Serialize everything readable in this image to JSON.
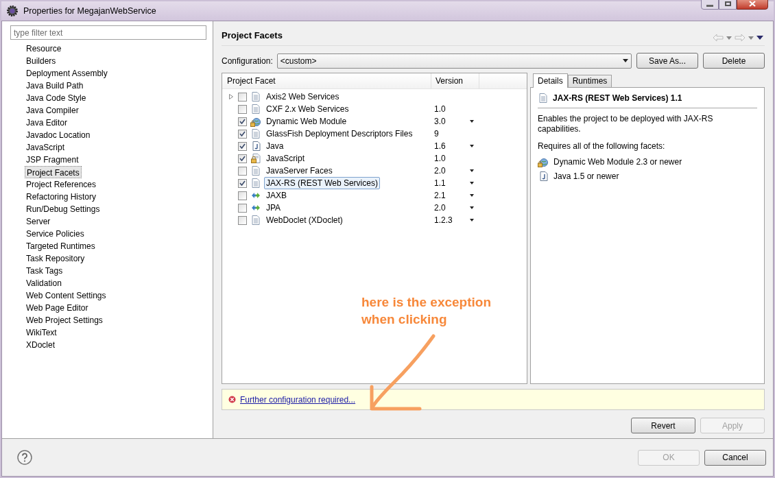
{
  "window": {
    "title": "Properties for MegajanWebService"
  },
  "filter": {
    "placeholder": "type filter text"
  },
  "sidebar": {
    "items": [
      {
        "label": "Resource",
        "selected": false
      },
      {
        "label": "Builders",
        "selected": false
      },
      {
        "label": "Deployment Assembly",
        "selected": false
      },
      {
        "label": "Java Build Path",
        "selected": false
      },
      {
        "label": "Java Code Style",
        "selected": false
      },
      {
        "label": "Java Compiler",
        "selected": false
      },
      {
        "label": "Java Editor",
        "selected": false
      },
      {
        "label": "Javadoc Location",
        "selected": false
      },
      {
        "label": "JavaScript",
        "selected": false
      },
      {
        "label": "JSP Fragment",
        "selected": false
      },
      {
        "label": "Project Facets",
        "selected": true
      },
      {
        "label": "Project References",
        "selected": false
      },
      {
        "label": "Refactoring History",
        "selected": false
      },
      {
        "label": "Run/Debug Settings",
        "selected": false
      },
      {
        "label": "Server",
        "selected": false
      },
      {
        "label": "Service Policies",
        "selected": false
      },
      {
        "label": "Targeted Runtimes",
        "selected": false
      },
      {
        "label": "Task Repository",
        "selected": false
      },
      {
        "label": "Task Tags",
        "selected": false
      },
      {
        "label": "Validation",
        "selected": false
      },
      {
        "label": "Web Content Settings",
        "selected": false
      },
      {
        "label": "Web Page Editor",
        "selected": false
      },
      {
        "label": "Web Project Settings",
        "selected": false
      },
      {
        "label": "WikiText",
        "selected": false
      },
      {
        "label": "XDoclet",
        "selected": false
      }
    ]
  },
  "page": {
    "title": "Project Facets"
  },
  "configuration": {
    "label": "Configuration:",
    "value": "<custom>",
    "buttons": [
      "Save As...",
      "Delete"
    ]
  },
  "facets": {
    "columns": [
      "Project Facet",
      "Version"
    ],
    "rows": [
      {
        "name": "Axis2 Web Services",
        "version": "",
        "kind": "doc",
        "checked": false,
        "expandable": true,
        "dropdown": false,
        "selected": false
      },
      {
        "name": "CXF 2.x Web Services",
        "version": "1.0",
        "kind": "doc",
        "checked": false,
        "expandable": false,
        "dropdown": false,
        "selected": false
      },
      {
        "name": "Dynamic Web Module",
        "version": "3.0",
        "kind": "web",
        "checked": true,
        "expandable": false,
        "dropdown": true,
        "selected": false
      },
      {
        "name": "GlassFish Deployment Descriptors Files",
        "version": "9",
        "kind": "doc",
        "checked": true,
        "expandable": false,
        "dropdown": false,
        "selected": false
      },
      {
        "name": "Java",
        "version": "1.6",
        "kind": "java",
        "checked": true,
        "expandable": false,
        "dropdown": true,
        "selected": false
      },
      {
        "name": "JavaScript",
        "version": "1.0",
        "kind": "locked-doc",
        "checked": true,
        "expandable": false,
        "dropdown": false,
        "selected": false
      },
      {
        "name": "JavaServer Faces",
        "version": "2.0",
        "kind": "doc",
        "checked": false,
        "expandable": false,
        "dropdown": true,
        "selected": false
      },
      {
        "name": "JAX-RS (REST Web Services)",
        "version": "1.1",
        "kind": "doc",
        "checked": true,
        "expandable": false,
        "dropdown": true,
        "selected": true
      },
      {
        "name": "JAXB",
        "version": "2.1",
        "kind": "arrows",
        "checked": false,
        "expandable": false,
        "dropdown": true,
        "selected": false
      },
      {
        "name": "JPA",
        "version": "2.0",
        "kind": "arrows",
        "checked": false,
        "expandable": false,
        "dropdown": true,
        "selected": false
      },
      {
        "name": "WebDoclet (XDoclet)",
        "version": "1.2.3",
        "kind": "doc",
        "checked": false,
        "expandable": false,
        "dropdown": true,
        "selected": false
      }
    ]
  },
  "details": {
    "tabs": [
      {
        "label": "Details",
        "selected": true
      },
      {
        "label": "Runtimes",
        "selected": false
      }
    ],
    "heading": "JAX-RS (REST Web Services) 1.1",
    "description": "Enables the project to be deployed with JAX-RS capabilities.",
    "requires_label": "Requires all of the following facets:",
    "requirements": [
      {
        "label": "Dynamic Web Module 2.3 or newer",
        "kind": "web"
      },
      {
        "label": "Java 1.5 or newer",
        "kind": "java"
      }
    ]
  },
  "message": {
    "link": "Further configuration required..."
  },
  "page_buttons": [
    {
      "label": "Revert",
      "disabled": false
    },
    {
      "label": "Apply",
      "disabled": true
    }
  ],
  "dialog_buttons": [
    {
      "label": "OK",
      "disabled": true
    },
    {
      "label": "Cancel",
      "disabled": false
    }
  ],
  "annotation": {
    "lines": [
      "here is the exception",
      "when clicking"
    ]
  }
}
